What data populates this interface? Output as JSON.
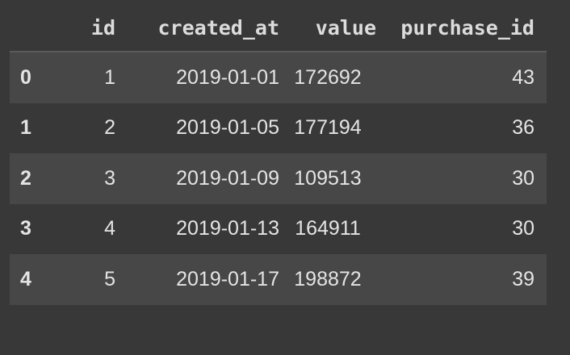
{
  "dataframe": {
    "columns": [
      "id",
      "created_at",
      "value",
      "purchase_id"
    ],
    "rows": [
      {
        "index": "0",
        "id": "1",
        "created_at": "2019-01-01",
        "value": "172692",
        "purchase_id": "43"
      },
      {
        "index": "1",
        "id": "2",
        "created_at": "2019-01-05",
        "value": "177194",
        "purchase_id": "36"
      },
      {
        "index": "2",
        "id": "3",
        "created_at": "2019-01-09",
        "value": "109513",
        "purchase_id": "30"
      },
      {
        "index": "3",
        "id": "4",
        "created_at": "2019-01-13",
        "value": "164911",
        "purchase_id": "30"
      },
      {
        "index": "4",
        "id": "5",
        "created_at": "2019-01-17",
        "value": "198872",
        "purchase_id": "39"
      }
    ]
  },
  "colors": {
    "background": "#383838",
    "row_stripe": "#474747",
    "text": "#e4e4e4"
  }
}
